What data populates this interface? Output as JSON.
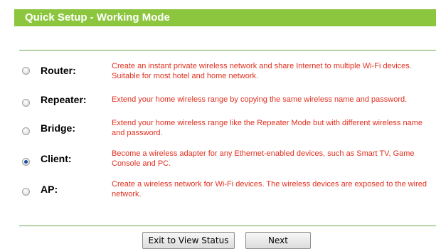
{
  "header": {
    "title": "Quick Setup - Working Mode"
  },
  "modes": [
    {
      "label": "Router:",
      "description": "Create an instant private wireless network and share Internet to multiple Wi-Fi devices. Suitable for most hotel and home network.",
      "selected": false
    },
    {
      "label": "Repeater:",
      "description": "Extend your home wireless range by copying the same wireless name and password.",
      "selected": false
    },
    {
      "label": "Bridge:",
      "description": "Extend your home wireless range like the Repeater Mode but with different wireless name and password.",
      "selected": false
    },
    {
      "label": "Client:",
      "description": "Become a wireless adapter for any Ethernet-enabled devices, such as Smart TV, Game Console and PC.",
      "selected": true
    },
    {
      "label": "AP:",
      "description": "Create a wireless network for Wi-Fi devices. The wireless devices are exposed to the wired network.",
      "selected": false
    }
  ],
  "buttons": {
    "exit_label": "Exit to View Status",
    "next_label": "Next"
  },
  "colors": {
    "title_bar": "#8cc63f",
    "description_text": "#e03020",
    "divider": "#6aa84f"
  }
}
